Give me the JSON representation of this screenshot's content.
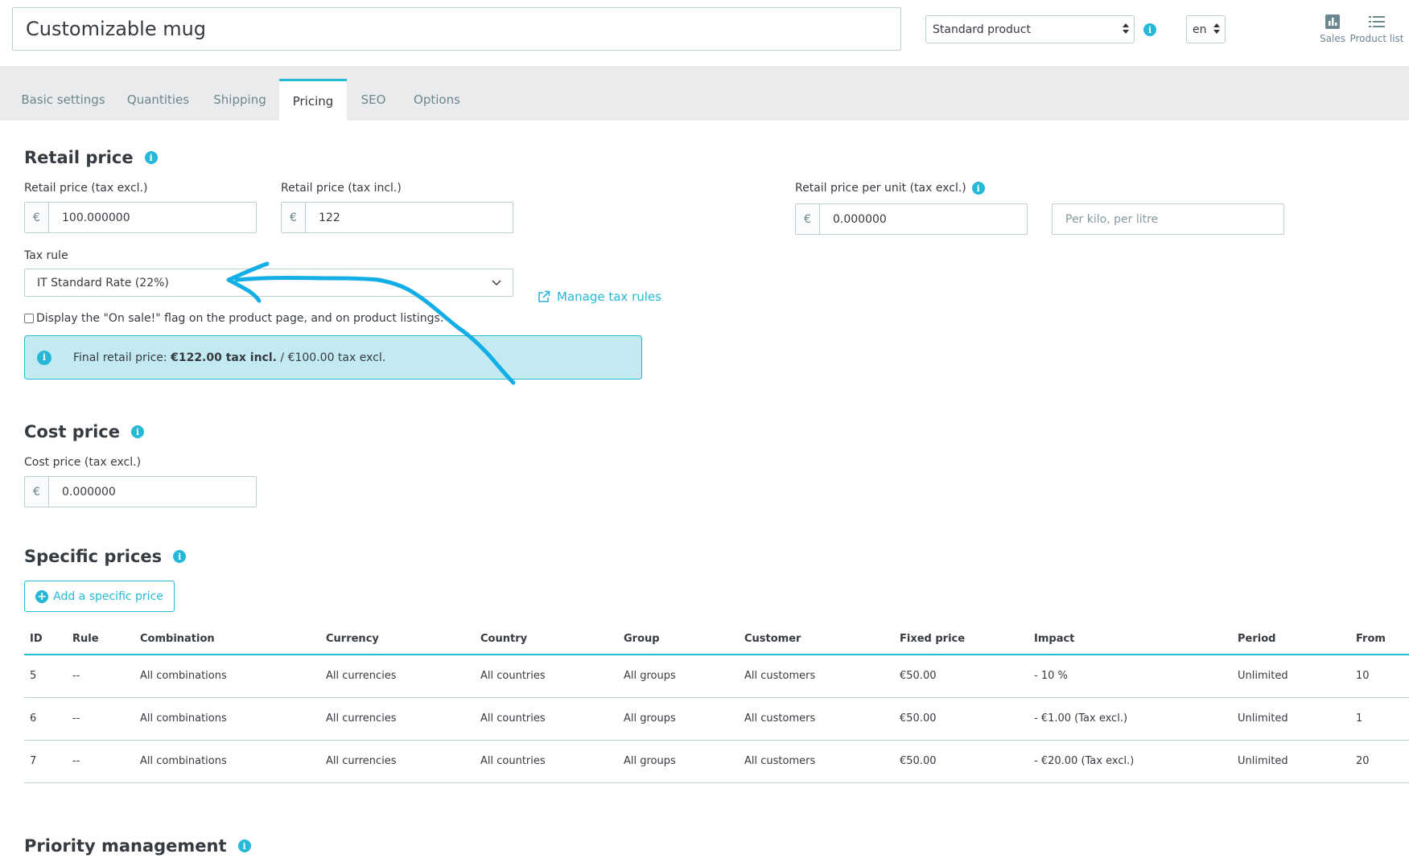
{
  "header": {
    "product_name": "Customizable mug",
    "product_type": "Standard product",
    "language": "en",
    "sales_label": "Sales",
    "product_list_label": "Product list"
  },
  "tabs": [
    {
      "label": "Basic settings",
      "active": false
    },
    {
      "label": "Quantities",
      "active": false
    },
    {
      "label": "Shipping",
      "active": false
    },
    {
      "label": "Pricing",
      "active": true
    },
    {
      "label": "SEO",
      "active": false
    },
    {
      "label": "Options",
      "active": false
    }
  ],
  "retail": {
    "title": "Retail price",
    "tax_excl_label": "Retail price (tax excl.)",
    "tax_excl_value": "100.000000",
    "tax_incl_label": "Retail price (tax incl.)",
    "tax_incl_value": "122",
    "currency_symbol": "€",
    "per_unit_label": "Retail price per unit (tax excl.)",
    "per_unit_value": "0.000000",
    "unit_placeholder": "Per kilo, per litre",
    "tax_rule_label": "Tax rule",
    "tax_rule_value": "IT Standard Rate (22%)",
    "manage_tax_rules": "Manage tax rules",
    "on_sale_label": "Display the \"On sale!\" flag on the product page, and on product listings.",
    "on_sale_checked": false,
    "final_price_prefix": "Final retail price: ",
    "final_price_incl": "€122.00 tax incl.",
    "final_price_suffix": " / €100.00 tax excl."
  },
  "cost": {
    "title": "Cost price",
    "label": "Cost price (tax excl.)",
    "value": "0.000000"
  },
  "specific": {
    "title": "Specific prices",
    "add_button": "Add a specific price",
    "columns": [
      "ID",
      "Rule",
      "Combination",
      "Currency",
      "Country",
      "Group",
      "Customer",
      "Fixed price",
      "Impact",
      "Period",
      "From"
    ],
    "rows": [
      [
        "5",
        "--",
        "All combinations",
        "All currencies",
        "All countries",
        "All groups",
        "All customers",
        "€50.00",
        "- 10 %",
        "Unlimited",
        "10"
      ],
      [
        "6",
        "--",
        "All combinations",
        "All currencies",
        "All countries",
        "All groups",
        "All customers",
        "€50.00",
        "- €1.00 (Tax excl.)",
        "Unlimited",
        "1"
      ],
      [
        "7",
        "--",
        "All combinations",
        "All currencies",
        "All countries",
        "All groups",
        "All customers",
        "€50.00",
        "- €20.00 (Tax excl.)",
        "Unlimited",
        "20"
      ]
    ]
  },
  "priority": {
    "title": "Priority management"
  },
  "colors": {
    "accent": "#25b9d7",
    "annotation_arrow": "#13aee6"
  }
}
